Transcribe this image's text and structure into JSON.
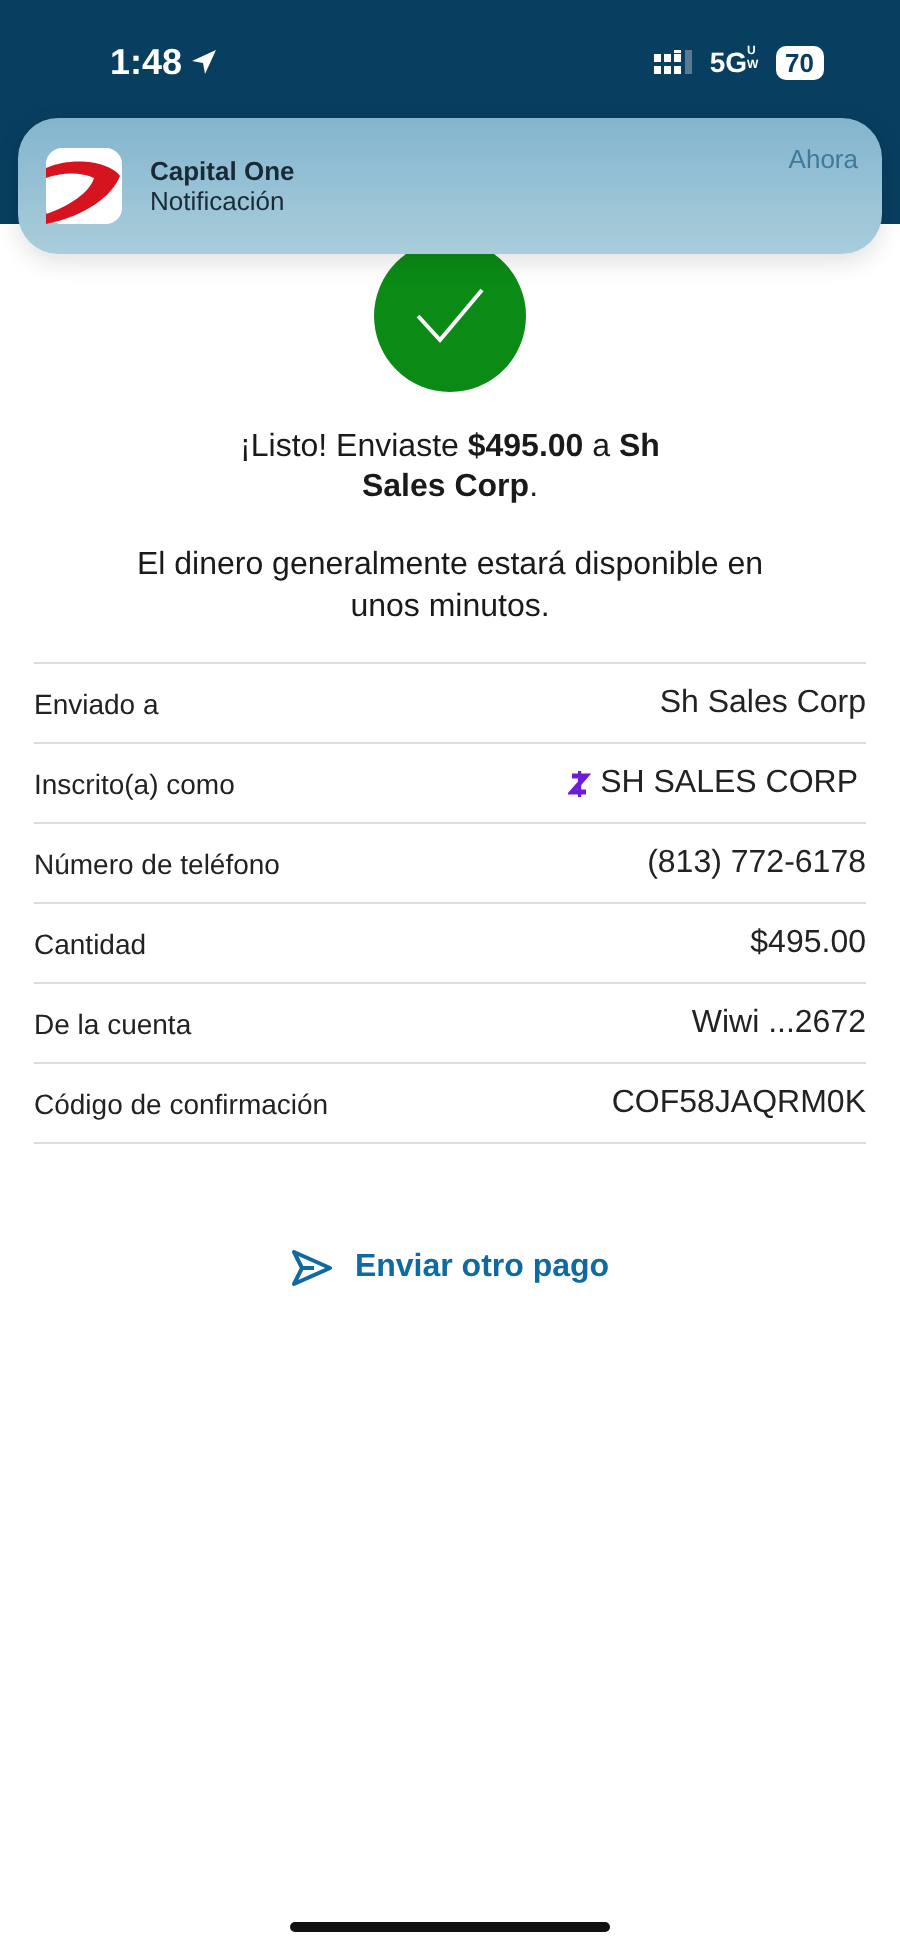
{
  "status_bar": {
    "time": "1:48",
    "network": "5G",
    "network_sub": "UW",
    "battery": "70"
  },
  "notification": {
    "app": "Capital One",
    "text": "Notificación",
    "time": "Ahora"
  },
  "confirmation": {
    "message": "¡Listo! Enviaste **$495.00** a **Sh Sales Corp**.",
    "note": "El dinero generalmente estará disponible en unos minutos."
  },
  "details": [
    {
      "kind": "plain",
      "label": "Enviado a",
      "value": "Sh Sales Corp"
    },
    {
      "kind": "zelle",
      "label": "Inscrito(a) como",
      "value": "SH SALES CORP"
    },
    {
      "kind": "plain",
      "label": "Número de teléfono",
      "value": "(813) 772-6178"
    },
    {
      "kind": "plain",
      "label": "Cantidad",
      "value": "$495.00"
    },
    {
      "kind": "plain",
      "label": "De la cuenta",
      "value": "Wiwi ...2672"
    },
    {
      "kind": "plain",
      "label": "Código de confirmación",
      "value": "COF58JAQRM0K"
    }
  ],
  "action": {
    "label": "Enviar otro pago"
  }
}
